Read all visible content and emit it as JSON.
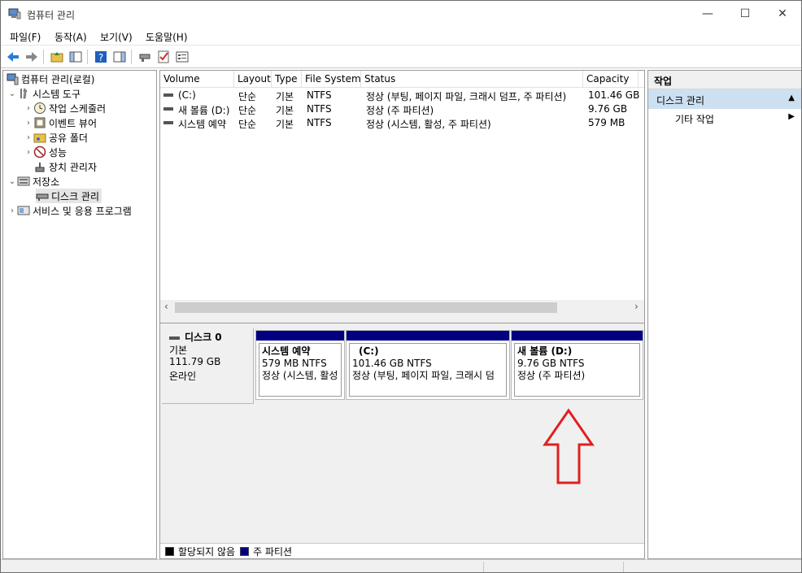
{
  "window": {
    "title": "컴퓨터 관리",
    "controls": {
      "minimize": "—",
      "maximize": "☐",
      "close": "✕"
    }
  },
  "menu": [
    "파일(F)",
    "동작(A)",
    "보기(V)",
    "도움말(H)"
  ],
  "tree": {
    "root": "컴퓨터 관리(로컬)",
    "system_tools": "시스템 도구",
    "task_scheduler": "작업 스케줄러",
    "event_viewer": "이벤트 뷰어",
    "shared_folders": "공유 폴더",
    "performance": "성능",
    "device_manager": "장치 관리자",
    "storage": "저장소",
    "disk_management": "디스크 관리",
    "services": "서비스 및 응용 프로그램"
  },
  "volume_list": {
    "columns": [
      "Volume",
      "Layout",
      "Type",
      "File System",
      "Status",
      "Capacity"
    ],
    "rows": [
      {
        "volume": "(C:)",
        "layout": "단순",
        "type": "기본",
        "fs": "NTFS",
        "status": "정상 (부팅, 페이지 파일, 크래시 덤프, 주 파티션)",
        "capacity": "101.46 GB"
      },
      {
        "volume": "새 볼륨 (D:)",
        "layout": "단순",
        "type": "기본",
        "fs": "NTFS",
        "status": "정상 (주 파티션)",
        "capacity": "9.76 GB"
      },
      {
        "volume": "시스템 예약",
        "layout": "단순",
        "type": "기본",
        "fs": "NTFS",
        "status": "정상 (시스템, 활성, 주 파티션)",
        "capacity": "579 MB"
      }
    ]
  },
  "disk": {
    "name": "디스크 0",
    "type": "기본",
    "size": "111.79 GB",
    "state": "온라인",
    "partitions": [
      {
        "name": "시스템 예약",
        "size": "579 MB NTFS",
        "status": "정상 (시스템, 활성"
      },
      {
        "name": "(C:)",
        "size": "101.46 GB NTFS",
        "status": "정상 (부팅, 페이지 파일, 크래시 덤"
      },
      {
        "name": "새 볼륨  (D:)",
        "size": "9.76 GB NTFS",
        "status": "정상 (주 파티션)"
      }
    ]
  },
  "legend": {
    "unallocated": "할당되지 않음",
    "primary": "주 파티션",
    "unallocated_color": "#000000",
    "primary_color": "#000080"
  },
  "actions": {
    "header": "작업",
    "section": "디스크 관리",
    "more": "기타 작업"
  },
  "annotation_color": "#e02020"
}
